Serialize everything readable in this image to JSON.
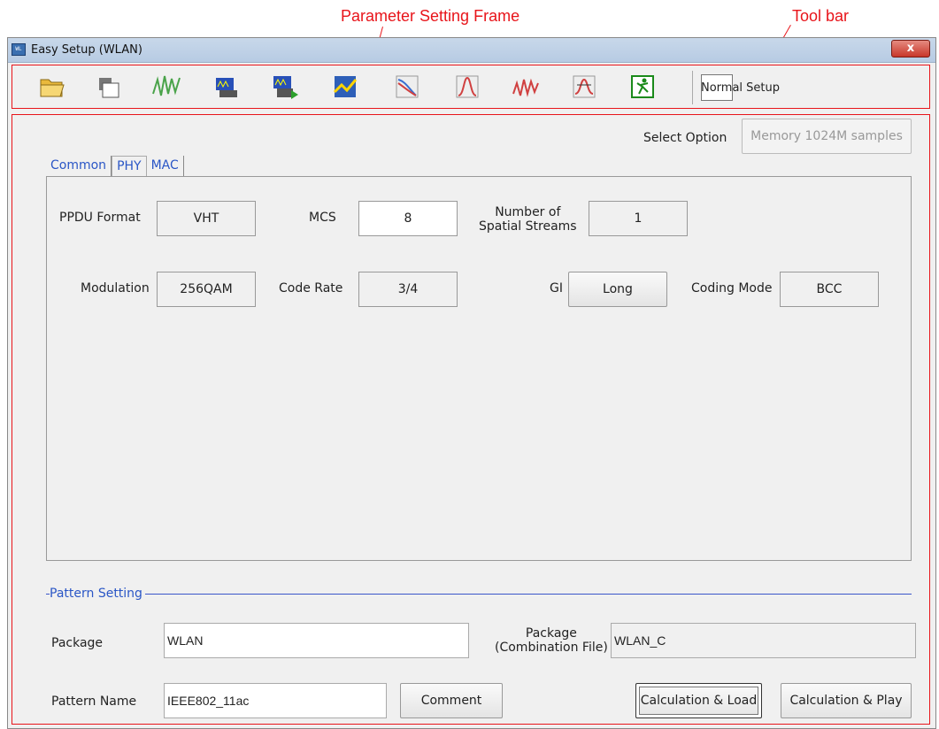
{
  "annotations": {
    "parameter_frame": "Parameter Setting Frame",
    "toolbar": "Tool bar"
  },
  "window": {
    "title": "Easy Setup (WLAN)",
    "close_label": "x"
  },
  "toolbar": {
    "buttons": [
      "open-icon",
      "save-icon",
      "waveform-icon",
      "transfer-icon",
      "transfer-play-icon",
      "graph-icon",
      "ccdf-icon",
      "fft-icon",
      "time-domain-icon",
      "clipping-icon",
      "exit-icon"
    ],
    "normal_setup_label": "Normal Setup"
  },
  "select_option": {
    "label": "Select Option",
    "button": "Memory 1024M samples"
  },
  "tabs": [
    "Common",
    "PHY",
    "MAC"
  ],
  "phy": {
    "ppdu_label": "PPDU Format",
    "ppdu_value": "VHT",
    "mcs_label": "MCS",
    "mcs_value": "8",
    "nss_label_1": "Number of",
    "nss_label_2": "Spatial Streams",
    "nss_value": "1",
    "mod_label": "Modulation",
    "mod_value": "256QAM",
    "rate_label": "Code Rate",
    "rate_value": "3/4",
    "gi_label": "GI",
    "gi_value": "Long",
    "coding_label": "Coding Mode",
    "coding_value": "BCC"
  },
  "pattern": {
    "group_label": "Pattern Setting",
    "package_label": "Package",
    "package_value": "WLAN",
    "combo_label_1": "Package",
    "combo_label_2": "(Combination File)",
    "combo_value": "WLAN_C",
    "name_label": "Pattern Name",
    "name_value": "IEEE802_11ac",
    "comment_button": "Comment",
    "calc_load_button": "Calculation & Load",
    "calc_play_button": "Calculation & Play"
  }
}
